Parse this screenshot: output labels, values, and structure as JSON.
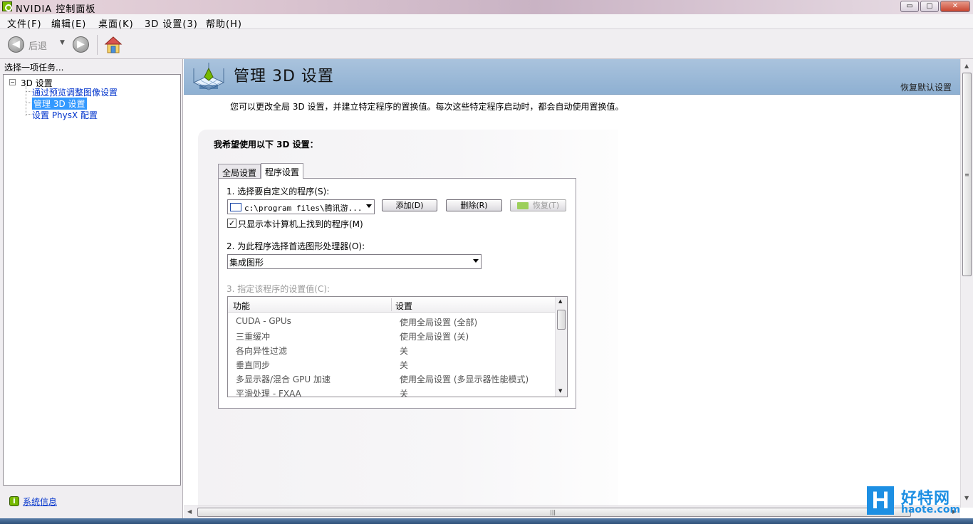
{
  "window": {
    "title": "NVIDIA 控制面板",
    "controls": {
      "minimize": "▭",
      "maximize": "▢",
      "close": "✕"
    }
  },
  "menu": [
    "文件(F)",
    "编辑(E)",
    "桌面(K)",
    "3D 设置(3)",
    "帮助(H)"
  ],
  "toolbar": {
    "back_label": "后退",
    "back_icon": "◀",
    "forward_icon": "▶",
    "dropdown": "▼"
  },
  "sidebar": {
    "prompt": "选择一项任务...",
    "tree": {
      "root": "3D 设置",
      "expander": "−",
      "items": [
        {
          "label": "通过预览调整图像设置"
        },
        {
          "label": "管理 3D 设置",
          "selected": true
        },
        {
          "label": "设置 PhysX 配置"
        }
      ]
    },
    "system_info_link": "系统信息"
  },
  "main": {
    "title": "管理 3D 设置",
    "restore_defaults": "恢复默认设置",
    "description": "您可以更改全局 3D 设置，并建立特定程序的置换值。每次这些特定程序启动时，都会自动使用置换值。",
    "section_heading": "我希望使用以下 3D 设置：",
    "tabs": [
      {
        "label": "全局设置",
        "active": false
      },
      {
        "label": "程序设置",
        "active": true
      }
    ],
    "step1": {
      "label": "1. 选择要自定义的程序(S):",
      "program_value": "c:\\program files\\腾讯游...",
      "add_button": "添加(D)",
      "delete_button": "删除(R)",
      "restore_button": "恢复(T)",
      "checkbox_label": "只显示本计算机上找到的程序(M)",
      "checkbox_checked": true,
      "check_mark": "✓"
    },
    "step2": {
      "label": "2. 为此程序选择首选图形处理器(O):",
      "selected": "集成图形"
    },
    "step3": {
      "label": "3. 指定该程序的设置值(C):",
      "columns": [
        "功能",
        "设置"
      ],
      "rows": [
        {
          "feature": "CUDA - GPUs",
          "setting": "使用全局设置 (全部)"
        },
        {
          "feature": "三重缓冲",
          "setting": "使用全局设置 (关)"
        },
        {
          "feature": "各向异性过滤",
          "setting": "关"
        },
        {
          "feature": "垂直同步",
          "setting": "关"
        },
        {
          "feature": "多显示器/混合 GPU 加速",
          "setting": "使用全局设置 (多显示器性能模式)"
        },
        {
          "feature": "平滑处理 - FXAA",
          "setting": "关"
        }
      ]
    }
  },
  "scrollbar": {
    "up": "▲",
    "down": "▼",
    "left": "◀",
    "right": "▶",
    "grip_v": "≡",
    "grip_h": "|||"
  },
  "watermark": {
    "logo_letter": "H",
    "name": "好特网",
    "url": "haote.com"
  },
  "colors": {
    "accent_green": "#76b900",
    "selection": "#3399ff",
    "banner": "#9fbcdb",
    "link": "#0033cc"
  }
}
